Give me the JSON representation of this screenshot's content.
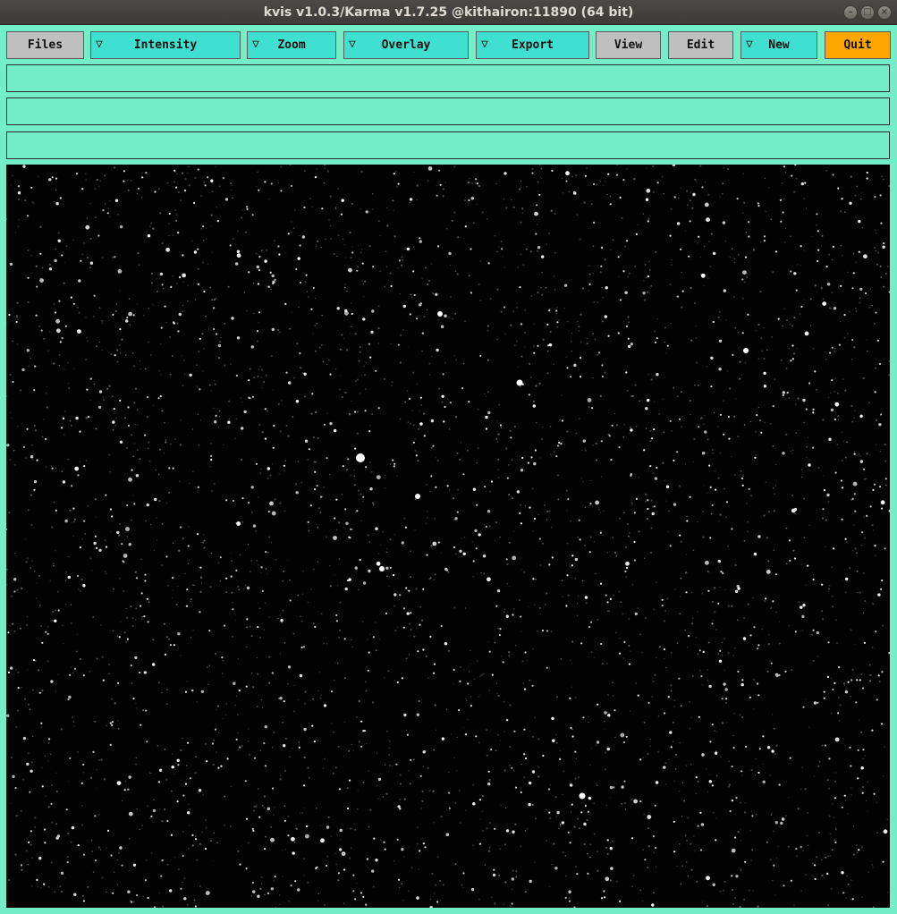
{
  "window": {
    "title": "kvis v1.0.3/Karma v1.7.25 @kithairon:11890 (64 bit)",
    "controls": {
      "minimize": "–",
      "maximize": "□",
      "close": "×"
    }
  },
  "toolbar": {
    "files": "Files",
    "intensity": "Intensity",
    "zoom": "Zoom",
    "overlay": "Overlay",
    "export": "Export",
    "view": "View",
    "edit": "Edit",
    "new": "New",
    "quit": "Quit",
    "menu_marker": "▽"
  },
  "info_lines": [
    "",
    "",
    ""
  ],
  "colors": {
    "panel_background": "#74edc9",
    "menu_button": "#3fe0cf",
    "plain_button": "#bfbfbf",
    "quit_button": "#ffa500",
    "image_background": "#030303"
  },
  "image": {
    "content": "starfield",
    "icon": "starfield-image"
  }
}
